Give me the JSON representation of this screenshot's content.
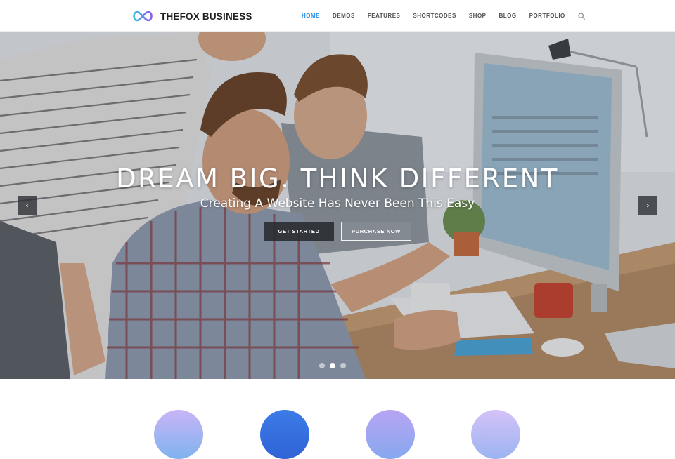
{
  "brand": {
    "name": "THEFOX BUSINESS",
    "logo_icon": "infinity-icon",
    "logo_colors": [
      "#3fc1e0",
      "#8a5cf0"
    ]
  },
  "nav": {
    "items": [
      {
        "label": "HOME",
        "active": true
      },
      {
        "label": "DEMOS",
        "active": false
      },
      {
        "label": "FEATURES",
        "active": false
      },
      {
        "label": "SHORTCODES",
        "active": false
      },
      {
        "label": "SHOP",
        "active": false
      },
      {
        "label": "BLOG",
        "active": false
      },
      {
        "label": "PORTFOLIO",
        "active": false
      }
    ],
    "search_icon": "search-icon",
    "accent_color": "#2f8fe6"
  },
  "hero": {
    "title": "DREAM BIG. THINK DIFFERENT",
    "subtitle": "Creating A Website Has Never Been This Easy",
    "primary_button": "GET STARTED",
    "secondary_button": "PURCHASE NOW",
    "prev_icon": "chevron-left-icon",
    "next_icon": "chevron-right-icon",
    "prev_glyph": "‹",
    "next_glyph": "›",
    "slides_total": 3,
    "active_slide": 2
  },
  "features": {
    "icon_colors": [
      "#b9a6f3",
      "#3d7be8",
      "#a99cf0",
      "#c8b8f6"
    ]
  }
}
